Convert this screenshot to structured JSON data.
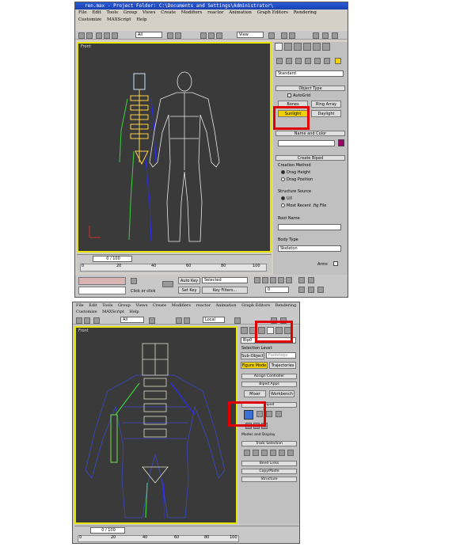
{
  "top": {
    "title": "ren.max   - Project Folder: C:\\Documents and Settings\\Administrator\\",
    "menu": [
      "File",
      "Edit",
      "Tools",
      "Group",
      "Views",
      "Create",
      "Modifiers",
      "reactor",
      "Animation",
      "Graph Editors",
      "Rendering"
    ],
    "menu2": [
      "Customize",
      "MAXScript",
      "Help"
    ],
    "toolbar": {
      "filter_value": "All",
      "ref_coord": "View"
    },
    "viewport_label": "Front",
    "panel": {
      "dropdown": "Standard",
      "object_type_title": "Object Type",
      "autogrid": "AutoGrid",
      "buttons": [
        "Bones",
        "Ring Array",
        "Sunlight",
        "Daylight"
      ],
      "name_color_title": "Name and Color",
      "create_biped_title": "Create Biped",
      "creation_method": "Creation Method",
      "drag_height": "Drag Height",
      "drag_position": "Drag Position",
      "structure_source": "Structure Source",
      "ui": "U/I",
      "most_recent": "Most Recent .fig File",
      "root_name": "Root Name",
      "body_type": "Body Type",
      "body_type_value": "Skeleton",
      "arms": "Arms"
    },
    "timeslider": "0 / 100",
    "ticks": [
      "0",
      "20",
      "40",
      "60",
      "80",
      "100"
    ],
    "status": {
      "prompt": "Click or click",
      "autokey": "Auto Key",
      "selected": "Selected",
      "setkey": "Set Key",
      "keyfilters": "Key Filters...",
      "frame": "0"
    },
    "colors": {
      "frame": "#e6e600",
      "highlight": "#e00000",
      "swatch": "#d8b4b4",
      "sunlight": "#f0d000",
      "color_chip": "#a0006a"
    }
  },
  "bottom": {
    "menu": [
      "File",
      "Edit",
      "Tools",
      "Group",
      "Views",
      "Create",
      "Modifiers",
      "reactor",
      "Animation",
      "Graph Editors",
      "Rendering"
    ],
    "menu2": [
      "Customize",
      "MAXScript",
      "Help"
    ],
    "toolbar": {
      "filter_value": "All",
      "ref_coord": "Local"
    },
    "viewport_label": "Front",
    "panel": {
      "object_name": "Bip0",
      "selection_level": "Selection Level:",
      "subobject": "Sub-Object",
      "subobject_value": "Footsteps",
      "tabs": [
        "Figure Mode",
        "Trajectories"
      ],
      "assign_controller": "Assign Controller",
      "biped_apps": "Biped Apps",
      "mixer": "Mixer",
      "workbench": "Workbench",
      "biped": "Biped",
      "modes_display": "Modes and Display",
      "track_selection": "Track Selection",
      "bend_links": "Bend Links",
      "copy_paste": "Copy/Paste",
      "structure": "Structure"
    },
    "timeslider": "0 / 100",
    "ticks": [
      "0",
      "20",
      "40",
      "60",
      "80",
      "100"
    ]
  }
}
